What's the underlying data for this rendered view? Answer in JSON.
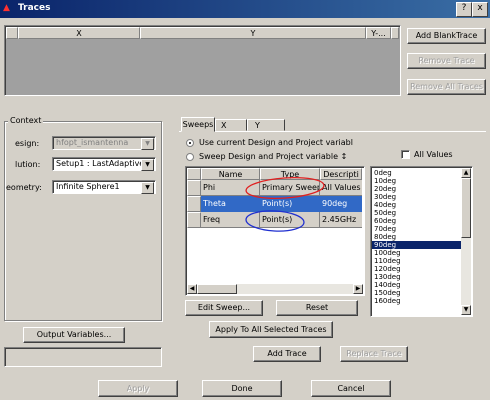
{
  "window": {
    "title": "Traces"
  },
  "title_buttons": {
    "help": "?",
    "close": "x"
  },
  "traces_table": {
    "columns": [
      "X",
      "Y",
      "Y-..."
    ]
  },
  "trace_buttons": {
    "add_blank": "Add BlankTrace",
    "remove": "Remove Trace",
    "remove_all": "Remove All Traces"
  },
  "context": {
    "group_label": "Context",
    "design_label": "esign:",
    "design_value": "hfopt_ismantenna",
    "solution_label": "lution:",
    "solution_value": "Setup1 : LastAdaptive",
    "geometry_label": "eometry:",
    "geometry_value": "Infinite Sphere1"
  },
  "output_variables": "Output Variables...",
  "tabs": [
    "Sweeps",
    "X",
    "Y"
  ],
  "sweeps": {
    "radio_use_current": "Use current Design and Project variabl",
    "radio_sweep": "Sweep Design and Project variable ↕",
    "all_values_label": "All Values",
    "grid": {
      "headers": [
        "Name",
        "Type",
        "Descripti"
      ],
      "rows": [
        {
          "name": "Phi",
          "type": "Primary Sweep",
          "desc": "All Values"
        },
        {
          "name": "Theta",
          "type": "Point(s)",
          "desc": "90deg"
        },
        {
          "name": "Freq",
          "type": "Point(s)",
          "desc": "2.45GHz"
        }
      ]
    },
    "values_list": [
      "0deg",
      "10deg",
      "20deg",
      "30deg",
      "40deg",
      "50deg",
      "60deg",
      "70deg",
      "80deg",
      "90deg",
      "100deg",
      "110deg",
      "120deg",
      "130deg",
      "140deg",
      "150deg",
      "160deg"
    ],
    "selected_value": "90deg",
    "edit_sweep": "Edit Sweep...",
    "reset": "Reset",
    "apply_all": "Apply To All Selected Traces"
  },
  "bottom_buttons": {
    "add_trace": "Add Trace",
    "replace_trace": "Replace Trace",
    "apply": "Apply",
    "done": "Done",
    "cancel": "Cancel"
  },
  "colors": {
    "selection": "#0a246a",
    "annotation_red": "#e02020",
    "annotation_blue": "#2030d0"
  }
}
